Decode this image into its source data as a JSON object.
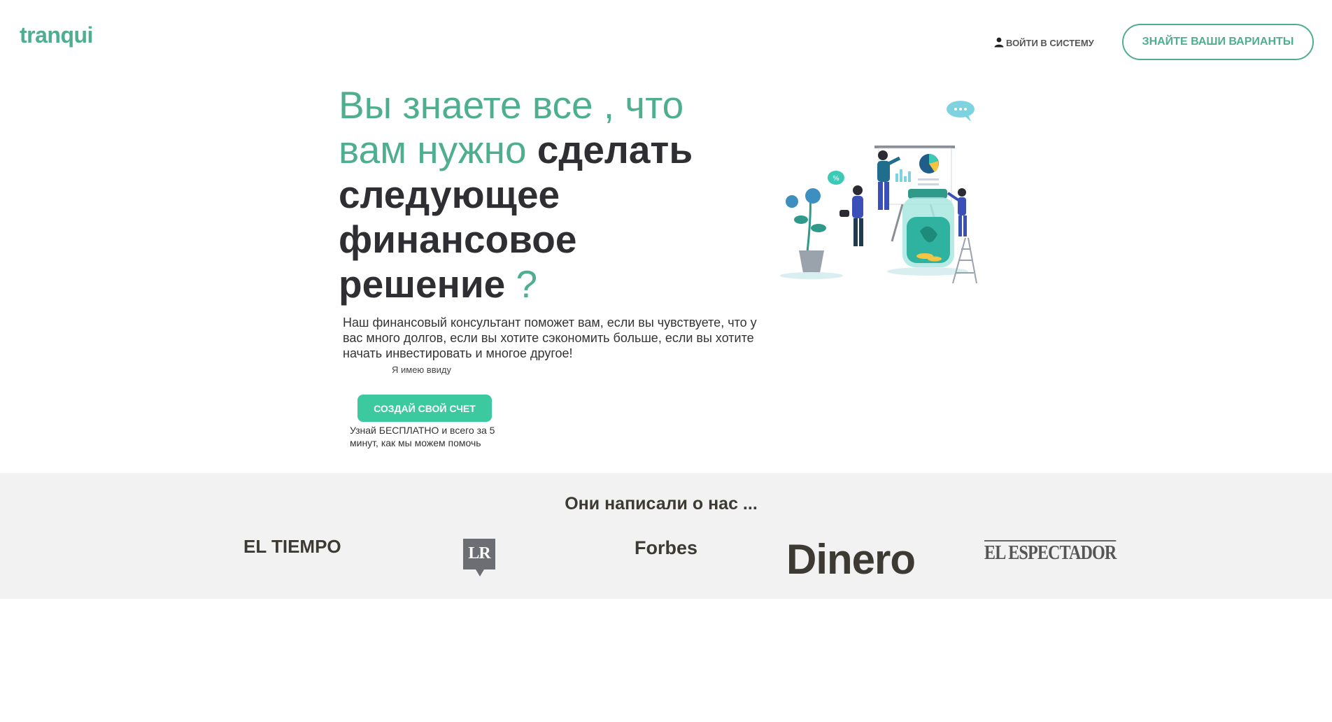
{
  "header": {
    "brand": "tranqui",
    "login_label": "ВОЙТИ В СИСТЕМУ",
    "login_icon": "user-icon",
    "options_button": "ЗНАЙТЕ ВАШИ ВАРИАНТЫ"
  },
  "hero": {
    "title_light": "Вы знаете все , что вам нужно ",
    "title_bold": "сделать следующее финансовое решение",
    "title_mark": " ?",
    "description": "Наш финансовый консультант поможет вам, если вы чувствуете, что у вас много долгов, если вы хотите сэкономить больше, если вы хотите начать инвестировать и многое другое!",
    "note": "Я имею ввиду",
    "cta_label": "СОЗДАЙ СВОЙ СЧЕТ",
    "cta_sub": "Узнай БЕСПЛАТНО и всего за 5 минут, как мы можем помочь",
    "illustration": "finance-team-illustration"
  },
  "press": {
    "title": "Они написали о нас ...",
    "logos": [
      "EL TIEMPO",
      "LR",
      "Forbes",
      "Dinero",
      "EL ESPECTADOR"
    ]
  },
  "colors": {
    "brand": "#4fae90",
    "cta": "#3cc99f",
    "dark_text": "#2f2f33",
    "press_bg": "#f2f2f2"
  }
}
